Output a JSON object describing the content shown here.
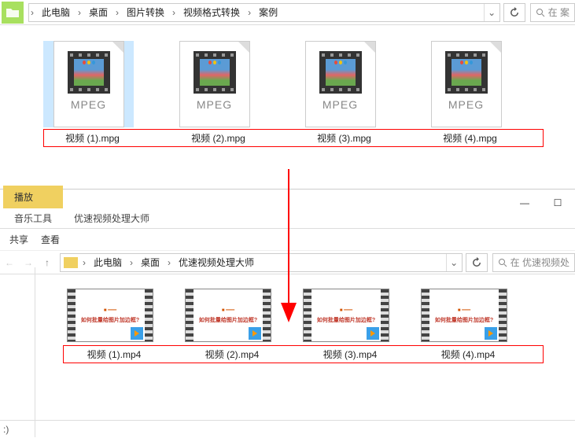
{
  "top": {
    "breadcrumb": [
      "此电脑",
      "桌面",
      "图片转换",
      "视频格式转换",
      "案例"
    ],
    "search_placeholder": "在 案"
  },
  "files_top": [
    {
      "name": "视频 (1).mpg",
      "type": "MPEG",
      "selected": true
    },
    {
      "name": "视频 (2).mpg",
      "type": "MPEG",
      "selected": false
    },
    {
      "name": "视频 (3).mpg",
      "type": "MPEG",
      "selected": false
    },
    {
      "name": "视频 (4).mpg",
      "type": "MPEG",
      "selected": false
    }
  ],
  "window2": {
    "ribbon": {
      "play_tab": "播放",
      "context": "优速视频处理大师",
      "music_tools": "音乐工具"
    },
    "toolbar": {
      "share": "共享",
      "view": "查看"
    },
    "breadcrumb": [
      "此电脑",
      "桌面",
      "优速视频处理大师"
    ],
    "search_placeholder": "在 优速视频处",
    "thumb_text": "如何批量给图片加边框?"
  },
  "files_bottom": [
    {
      "name": "视频 (1).mp4"
    },
    {
      "name": "视频 (2).mp4"
    },
    {
      "name": "视频 (3).mp4"
    },
    {
      "name": "视频 (4).mp4"
    }
  ],
  "status": ":)"
}
